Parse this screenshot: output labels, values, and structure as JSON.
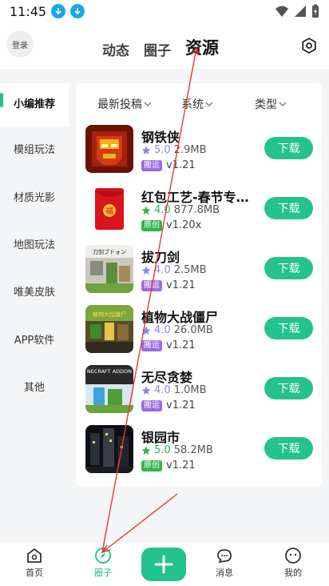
{
  "status": {
    "time": "11:45"
  },
  "header": {
    "login_label": "登录",
    "tabs": [
      "动态",
      "圈子",
      "资源"
    ],
    "active_tab": "资源"
  },
  "sidebar": {
    "items": [
      "小编推荐",
      "模组玩法",
      "材质光影",
      "地图玩法",
      "唯美皮肤",
      "APP软件",
      "其他"
    ]
  },
  "filters": [
    "最新投稿",
    "系统",
    "类型"
  ],
  "apps": [
    {
      "name": "钢铁侠",
      "rating": "5.0",
      "size": "2.9MB",
      "tag": "搬运",
      "version": "v1.21",
      "download": "下载"
    },
    {
      "name": "红包工艺-春节专...",
      "rating": "4.0",
      "size": "877.8MB",
      "tag": "原创",
      "version": "v1.20x",
      "download": "下载"
    },
    {
      "name": "拔刀剑",
      "rating": "4.0",
      "size": "2.5MB",
      "tag": "搬运",
      "version": "v1.21",
      "download": "下载"
    },
    {
      "name": "植物大战僵尸",
      "rating": "4.0",
      "size": "26.0MB",
      "tag": "搬运",
      "version": "v1.21",
      "download": "下载"
    },
    {
      "name": "无尽贪婪",
      "rating": "4.0",
      "size": "1.0MB",
      "tag": "搬运",
      "version": "v1.21",
      "download": "下载"
    },
    {
      "name": "银园市",
      "rating": "5.0",
      "size": "58.2MB",
      "tag": "原创",
      "version": "v1.21",
      "download": "下载"
    }
  ],
  "icon_text": {
    "hongbao": "福",
    "badao": "刀剑ブドォン",
    "zombie": "植物大战僵尸",
    "neec": "NECRAFT ADDON"
  },
  "bottom_nav": [
    "首页",
    "圈子",
    "消息",
    "我的"
  ],
  "colors": {
    "accent": "#23c28f",
    "tag_ban": "#9a6adf",
    "tag_yuan": "#2fb44f",
    "star": "#8f86e8"
  }
}
